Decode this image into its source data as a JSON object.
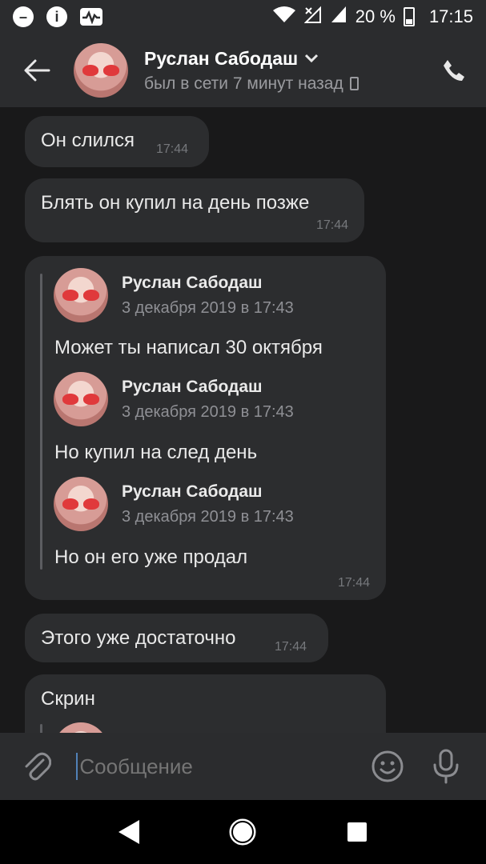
{
  "status_bar": {
    "battery": "20 %",
    "time": "17:15"
  },
  "header": {
    "contact_name": "Руслан Сабодаш",
    "contact_status": "был в сети 7 минут назад"
  },
  "messages": [
    {
      "text": "Он слился",
      "time": "17:44"
    },
    {
      "text": "Блять он купил на день позже",
      "time": "17:44"
    },
    {
      "time": "17:44",
      "forwarded": [
        {
          "author": "Руслан Сабодаш",
          "date": "3 декабря 2019 в 17:43",
          "text": "Может ты написал 30 октября"
        },
        {
          "author": "Руслан Сабодаш",
          "date": "3 декабря 2019 в 17:43",
          "text": "Но купил на след день"
        },
        {
          "author": "Руслан Сабодаш",
          "date": "3 декабря 2019 в 17:43",
          "text": "Но он его уже продал"
        }
      ]
    },
    {
      "text": "Этого уже достаточно",
      "time": "17:44"
    },
    {
      "text": "Скрин"
    }
  ],
  "composer": {
    "placeholder": "Сообщение"
  },
  "icons": {
    "back": "arrow-left-icon",
    "call": "phone-icon",
    "attach": "paperclip-icon",
    "emoji": "smile-icon",
    "mic": "microphone-icon"
  }
}
